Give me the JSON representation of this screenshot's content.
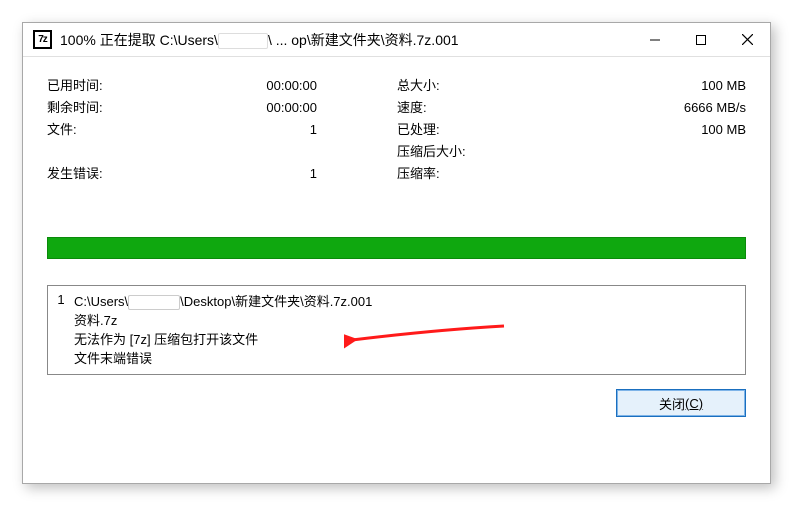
{
  "window": {
    "icon_label": "7z",
    "title_prefix": "100% 正在提取 C:\\Users\\",
    "title_suffix": "\\ ... op\\新建文件夹\\资料.7z.001"
  },
  "stats": {
    "left": {
      "elapsed_label": "已用时间:",
      "elapsed_value": "00:00:00",
      "remaining_label": "剩余时间:",
      "remaining_value": "00:00:00",
      "files_label": "文件:",
      "files_value": "1",
      "errors_label": "发生错误:",
      "errors_value": "1"
    },
    "right": {
      "total_label": "总大小:",
      "total_value": "100 MB",
      "speed_label": "速度:",
      "speed_value": "6666 MB/s",
      "processed_label": "已处理:",
      "processed_value": "100 MB",
      "packed_label": "压缩后大小:",
      "packed_value": "",
      "ratio_label": "压缩率:",
      "ratio_value": ""
    }
  },
  "list": {
    "index": "1",
    "path_prefix": "C:\\Users\\",
    "path_suffix": "\\Desktop\\新建文件夹\\资料.7z.001",
    "line2": "资料.7z",
    "line3": "无法作为 [7z] 压缩包打开该文件",
    "line4": "文件末端错误"
  },
  "buttons": {
    "close_main": "关闭",
    "close_accel": "(C)"
  }
}
